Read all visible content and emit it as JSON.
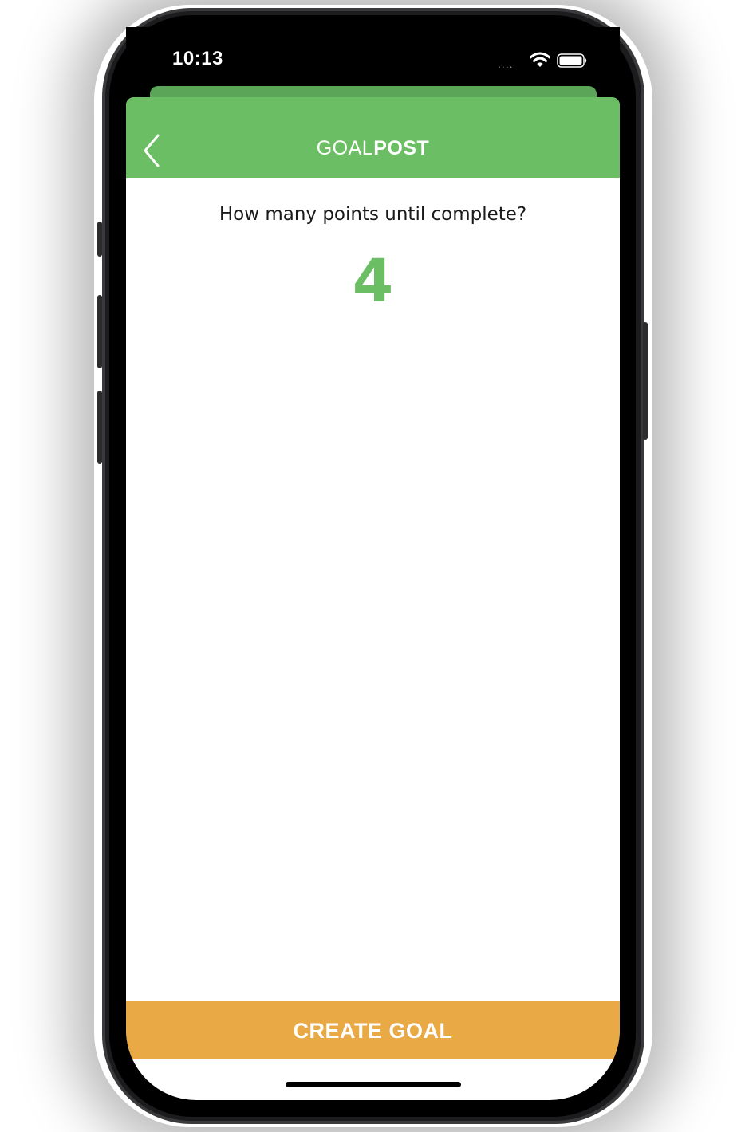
{
  "status_bar": {
    "time": "10:13",
    "signal_dots": "....",
    "wifi_icon": "wifi-icon",
    "battery_icon": "battery-icon"
  },
  "nav": {
    "title_light": "GOAL",
    "title_bold": "POST",
    "back_icon": "chevron-left-icon"
  },
  "form": {
    "question": "How many points until complete?",
    "points_value": "4"
  },
  "footer": {
    "create_label": "CREATE GOAL"
  },
  "colors": {
    "header_green": "#6cbe64",
    "header_green_back_card": "#5aa558",
    "accent_orange": "#e9a944",
    "value_green": "#6cbe64",
    "text_dark": "#1a1a1a",
    "background": "#ffffff"
  }
}
